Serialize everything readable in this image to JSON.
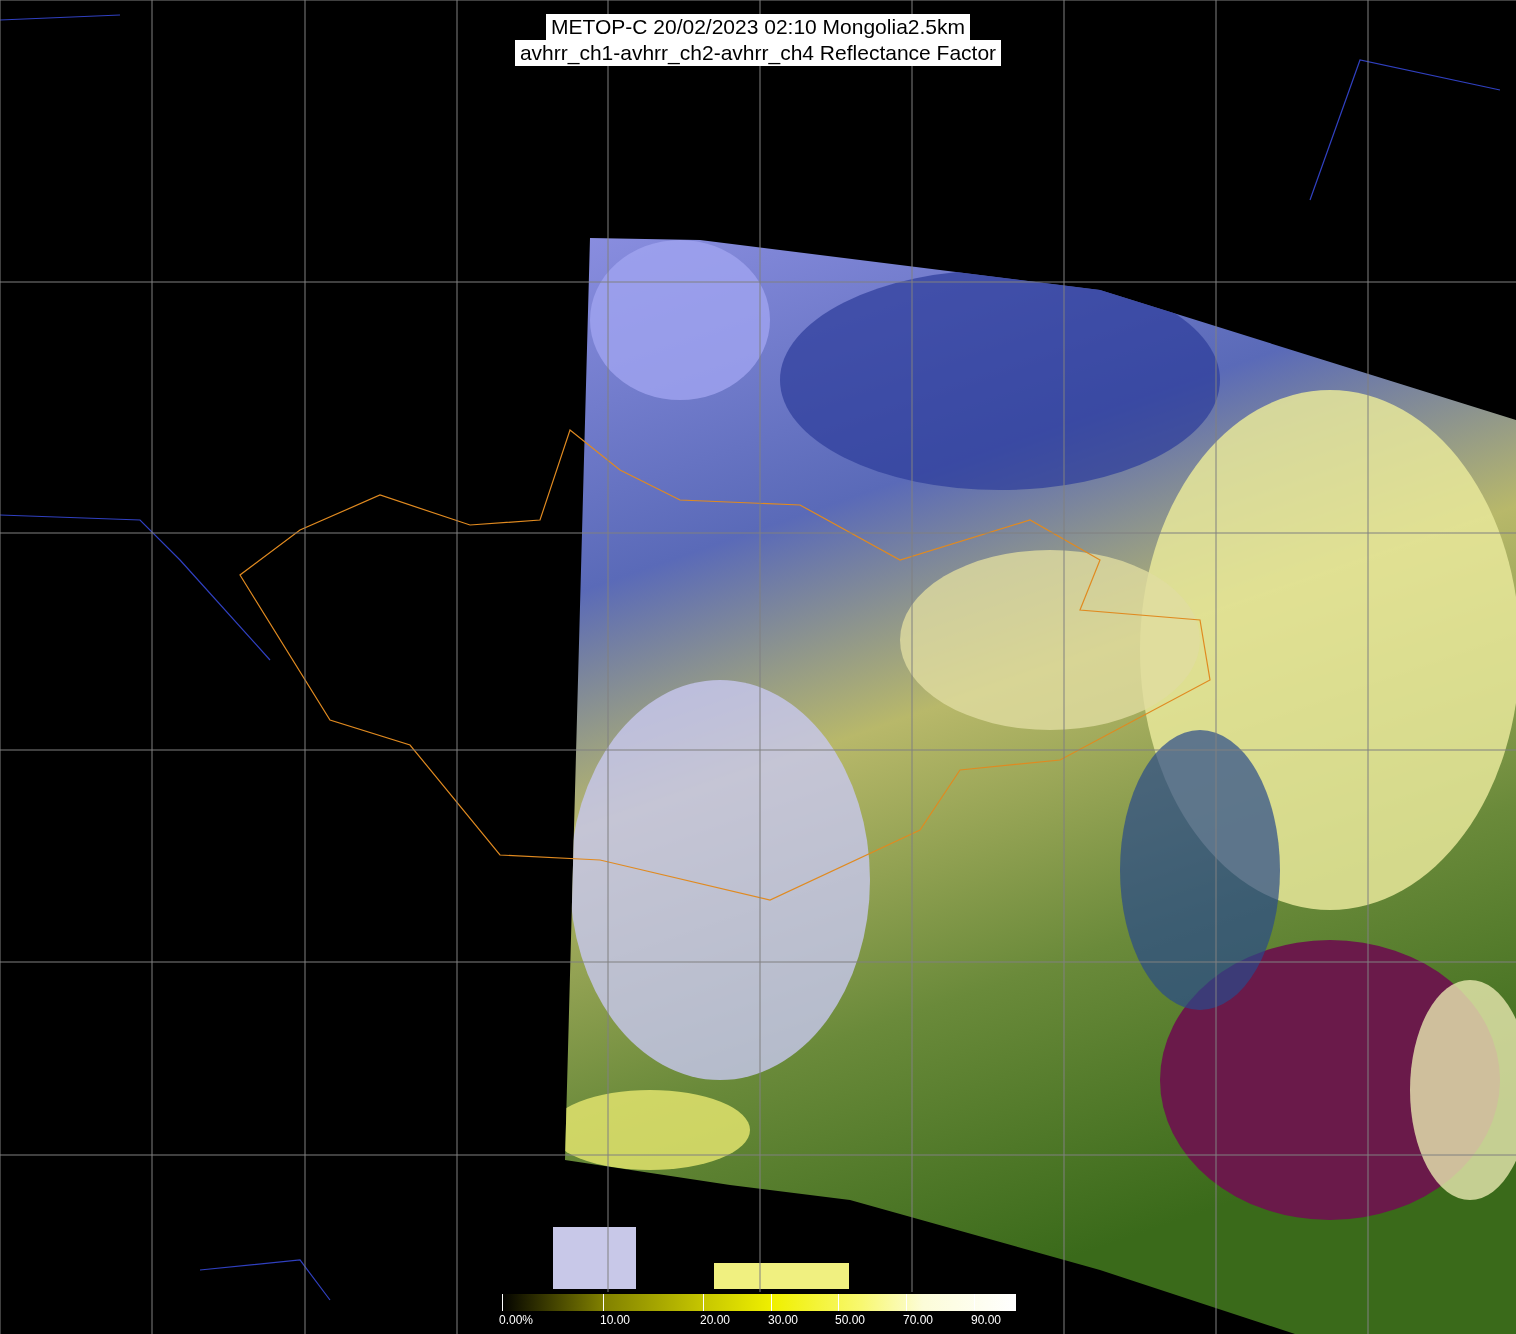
{
  "title": {
    "lines": [
      "METOP-C 20/02/2023 02:10 Mongolia2.5km",
      "avhrr_ch1-avhrr_ch2-avhrr_ch4 Reflectance Factor"
    ]
  },
  "colorbar": {
    "ticks": [
      "0.00%",
      "10.00",
      "20.00",
      "30.00",
      "50.00",
      "70.00",
      "90.00"
    ]
  }
}
